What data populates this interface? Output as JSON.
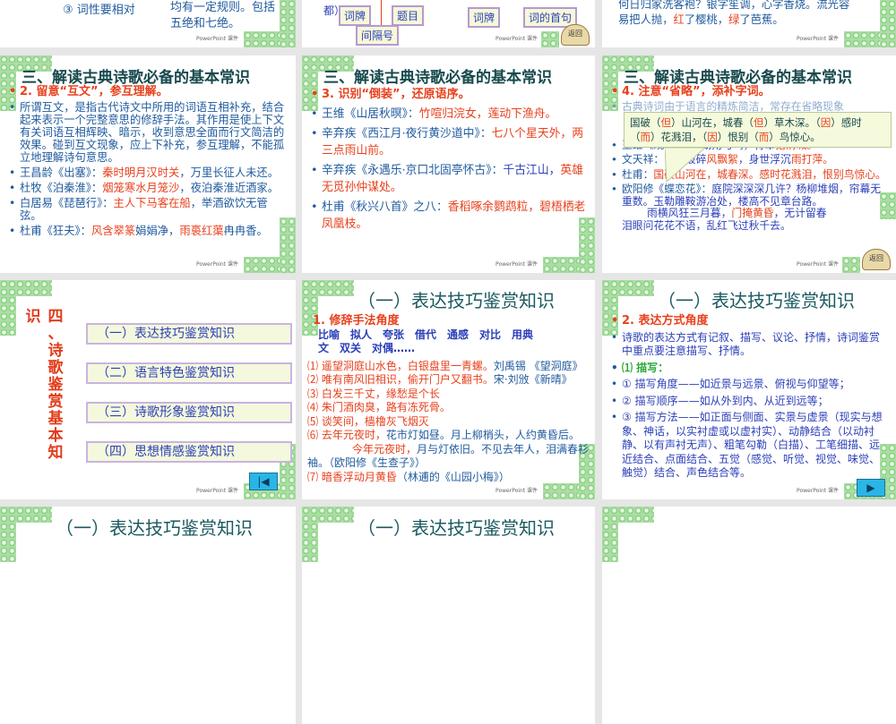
{
  "top_row": {
    "left": {
      "item": "③ 词性要相对",
      "text1": "均有一定规则。包括",
      "text2": "五绝和七绝。"
    },
    "middle": {
      "prefix": "都）",
      "boxes": [
        "词牌",
        "题目",
        "间隔号",
        "词牌",
        "词的首句"
      ],
      "return_label": "返回"
    },
    "right": {
      "line1": "何日归家洗客袍？银字笙调，心字香烧。流光容",
      "line2a": "易把人抛，",
      "line2b": "红",
      "line2c": "了樱桃，",
      "line2d": "绿",
      "line2e": "了芭蕉。"
    }
  },
  "watermark": "PowerPoint 课件",
  "slide_huwen": {
    "title": "三、解读古典诗歌必备的基本常识",
    "subtitle": "2. 留意“互文”，参互理解。",
    "para": "所谓互文，是指古代诗文中所用的词语互相补充，结合起来表示一个完整意思的修辞手法。其作用是使上下文有关词语互相辉映、暗示，收到意思全面而行文简洁的效果。碰到互文现象，应上下补充，参互理解，不能孤立地理解诗句意思。",
    "examples": [
      {
        "src": "王昌龄《出塞》：",
        "red": "秦时明月汉时关",
        "rest": "，万里长征人未还。"
      },
      {
        "src": "杜牧《泊秦淮》：",
        "red": "烟笼寒水月笼沙",
        "rest": "，夜泊秦淮近酒家。"
      },
      {
        "src": "白居易《琵琶行》：",
        "red": "主人下马客在船",
        "rest": "，举酒欲饮无管弦。"
      },
      {
        "src": "杜甫《狂夫》：",
        "red": "风含翠篆",
        "mid": "娟娟净，",
        "red2": "雨裛红蕖",
        "rest": "冉冉香。"
      }
    ]
  },
  "slide_daozhuang": {
    "title": "三、解读古典诗歌必备的基本常识",
    "subtitle": "3. 识别“倒装”，还原语序。",
    "examples": [
      {
        "src": "王维《山居秋暝》：",
        "red": "竹喧归浣女，莲动下渔舟。"
      },
      {
        "src": "辛弃疾《西江月·夜行黄沙道中》：",
        "red": "七八个星天外，两三点雨山前。"
      },
      {
        "src": "辛弃疾《永遇乐·京口北固亭怀古》：",
        "blue": "千古江山，",
        "red": "英雄无觅孙仲谋处。"
      },
      {
        "src": "杜甫《秋兴八首》之八：",
        "red": "香稻啄余鹦鹉粒，碧梧栖老凤凰枝。"
      }
    ]
  },
  "slide_shenglue": {
    "title": "三、解读古典诗歌必备的基本常识",
    "subtitle": "4. 注意“省略”，添补字词。",
    "hidden_line": "古典诗词由于语言的精炼简洁，常存在省略现象",
    "callout": {
      "a": "国破（",
      "b": "但",
      "c": "）山河在，城春（",
      "d": "但",
      "e": "）草木深。（",
      "f": "因",
      "g": "）感时（",
      "h": "而",
      "i": "）花溅泪，（",
      "j": "因",
      "k": "）恨别（",
      "l": "而",
      "m": "）鸟惊心。"
    },
    "examples": [
      {
        "src": "王维《观猎》：",
        "blue": "风劲角弓鸣，将军",
        "red": "猎渭城。"
      },
      {
        "src": "文天祥：",
        "blue": "山河破碎",
        "red": "风飘絮",
        "blue2": "，身世浮沉",
        "red2": "雨打萍。"
      },
      {
        "src": "杜甫：",
        "red": "国破山河在，",
        "red_b": "城春深。感时花溅泪，恨别鸟惊心。"
      },
      {
        "src": "欧阳修《蝶恋花》：",
        "blue": "庭院深深深几许？杨柳堆烟，帘幕无重数。玉勒雕鞍游冶处，楼高不见章台路。",
        "line2a": "雨横风狂三月暮，",
        "red": "门掩黄昏",
        "line2b": "，无计留春",
        "line3": "泪眼问花花不语，乱红飞过秋千去。"
      }
    ],
    "return_label": "返回"
  },
  "slide_menu": {
    "vertical_title": [
      "识",
      "四",
      "、",
      "诗",
      "歌",
      "鉴",
      "赏",
      "基",
      "本",
      "知"
    ],
    "items": [
      "（一）表达技巧鉴赏知识",
      "（二）语言特色鉴赏知识",
      "（三）诗歌形象鉴赏知识",
      "（四）思想情感鉴赏知识"
    ],
    "back_icon": "first-slide-icon"
  },
  "slide_xiuci": {
    "title": "（一）表达技巧鉴赏知识",
    "subtitle": "1. 修辞手法角度",
    "terms1": "比喻　拟人　夸张　借代　通感　对比　用典",
    "terms2": "文　双关　对偶……",
    "examples": [
      {
        "red": "⑴ 遥望洞庭山水色，白银盘里一青螺。",
        "src": "刘禹锡 《望洞庭》"
      },
      {
        "red": "⑵ 唯有南风旧相识，偷开门户又翻书。",
        "src": "宋·刘攽《新晴》"
      },
      {
        "red": "⑶ 白发三千丈，缘愁是个长"
      },
      {
        "red": "⑷ 朱门酒肉臭，路有冻死骨。"
      },
      {
        "red": "⑸ 谈笑间，樯橹灰飞烟灭"
      },
      {
        "red": "⑹ 去年元夜时，",
        "src": "花市灯如昼。月上柳梢头，人约黄昏后。"
      },
      {
        "indent": "今年元夜时，",
        "src": "月与灯依旧。不见去年人，泪满春衫袖。（欧阳修《生查子》）"
      },
      {
        "red": "⑺ 暗香浮动月黄昏",
        "src": "（林逋的《山园小梅》）"
      }
    ]
  },
  "slide_biaoda": {
    "title": "（一）表达技巧鉴赏知识",
    "subtitle": "2. 表达方式角度",
    "items": [
      "诗歌的表达方式有记叙、描写、议论、抒情，诗词鉴赏中重点要注意描写、抒情。",
      "⑴ 描写：",
      "① 描写角度——如近景与远景、俯视与仰望等；",
      "② 描写顺序——如从外到内、从近到远等；",
      "③ 描写方法——如正面与侧面、实景与虚景（现实与想象、神话，以实衬虚或以虚衬实）、动静结合（以动衬静、以有声衬无声）、粗笔勾勒（白描）、工笔细描、远近结合、点面结合、五觉（感觉、听觉、视觉、味觉、触觉）结合、声色结合等。"
    ],
    "next_icon": "next-slide-icon"
  },
  "bottom_row": {
    "titles": [
      "（一）表达技巧鉴赏知识",
      "（一）表达技巧鉴赏知识"
    ]
  },
  "colors": {
    "red": "#e8401c",
    "blue": "#1f5a9e",
    "title": "#17494d",
    "ornament": "#a9dfa2"
  }
}
